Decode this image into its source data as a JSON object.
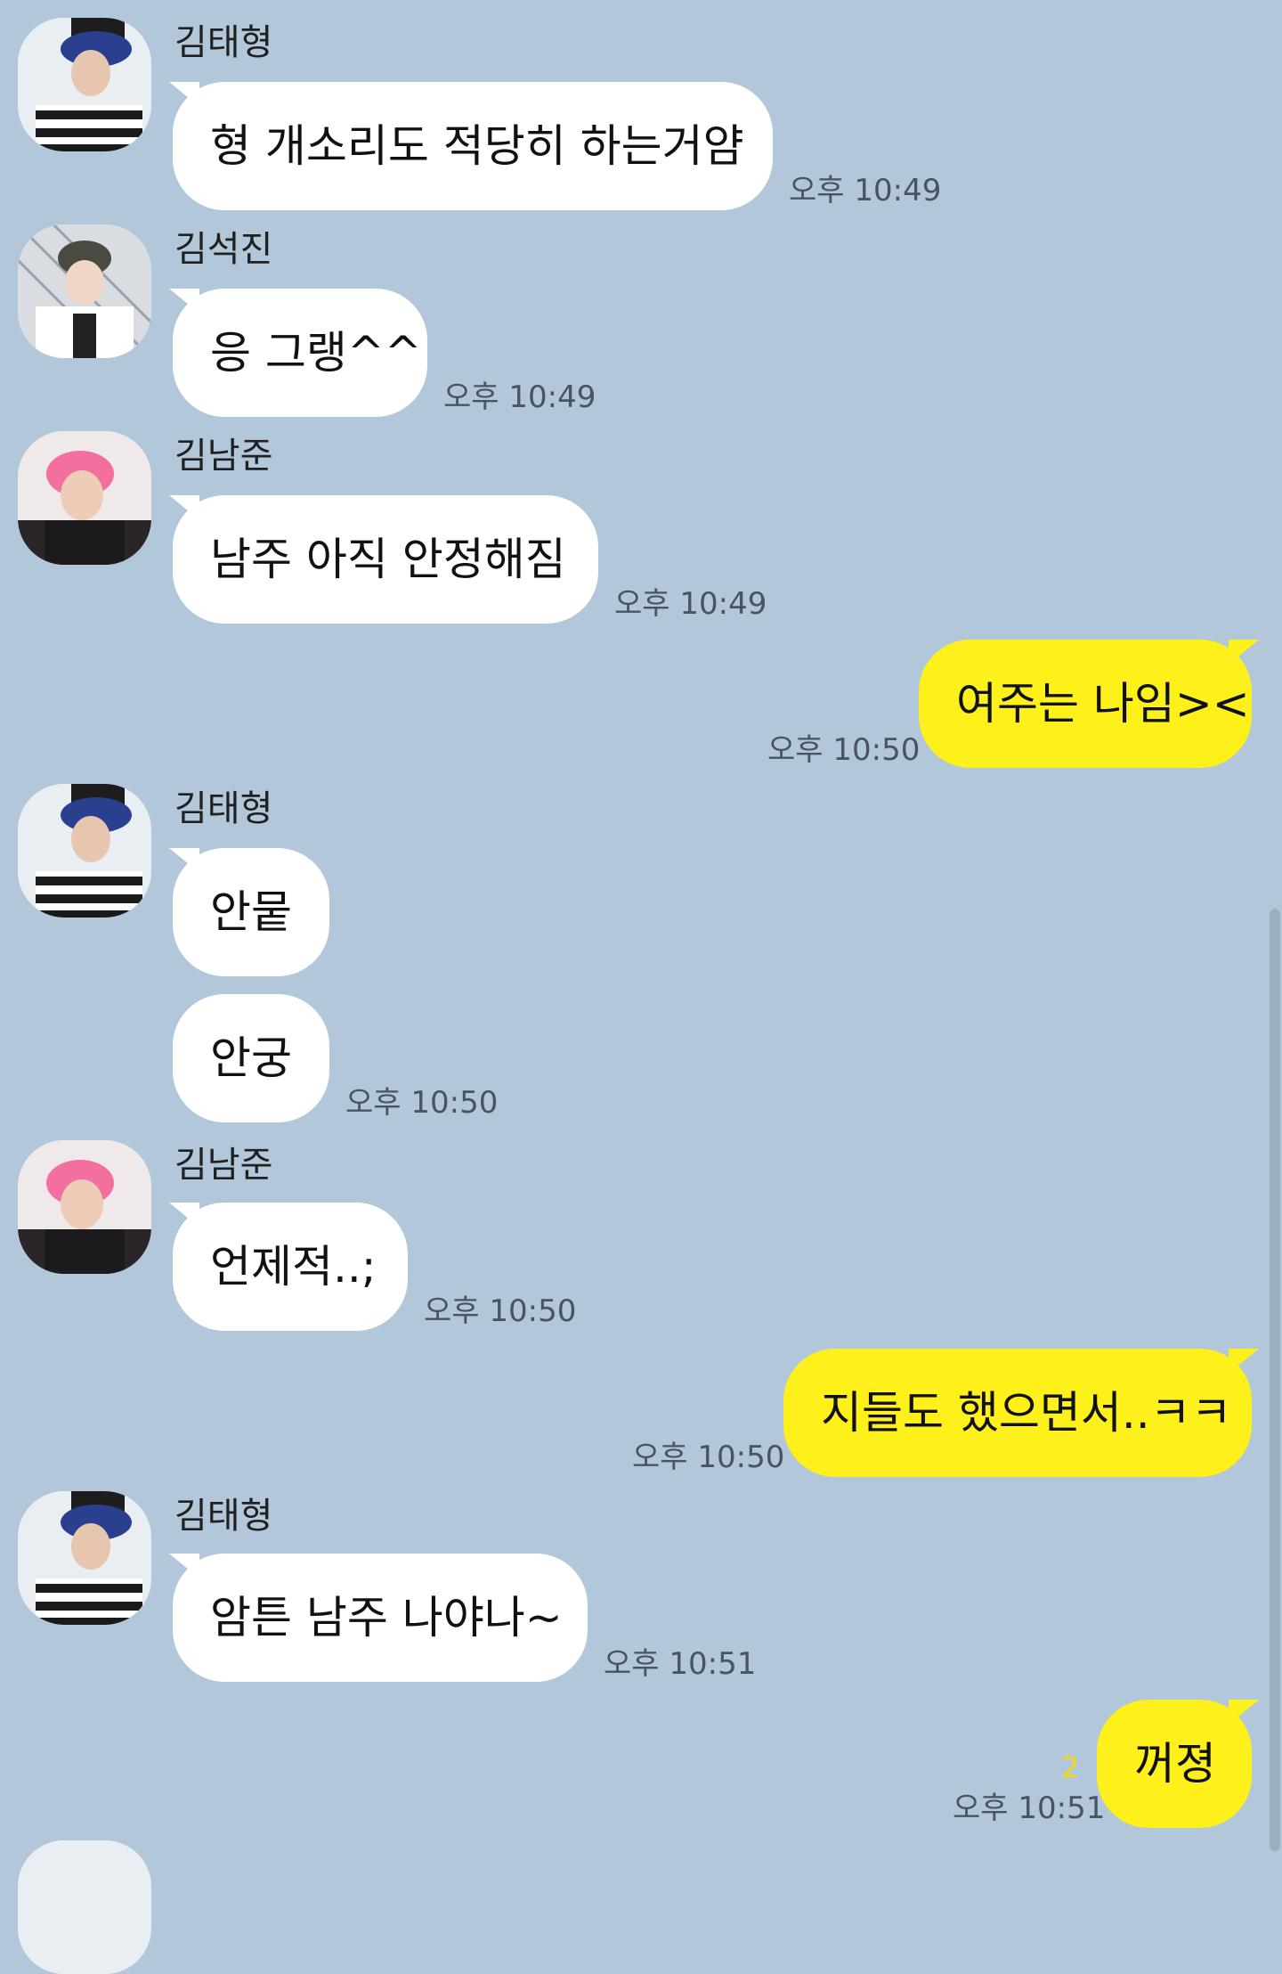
{
  "messages": {
    "m1": {
      "sender": "김태형",
      "text": "형 개소리도 적당히 하는거얌",
      "time": "오후 10:49"
    },
    "m2": {
      "sender": "김석진",
      "text": "응 그랭^^",
      "time": "오후 10:49"
    },
    "m3": {
      "sender": "김남준",
      "text": "남주 아직 안정해짐",
      "time": "오후 10:49"
    },
    "m4": {
      "text": "여주는 나임><",
      "time": "오후 10:50"
    },
    "m5": {
      "sender": "김태형",
      "text": "안뭍",
      "text2": "안궁",
      "time": "오후 10:50"
    },
    "m6": {
      "sender": "김남준",
      "text": "언제적..;",
      "time": "오후 10:50"
    },
    "m7": {
      "text": "지들도 했으면서..ㅋㅋ",
      "time": "오후 10:50"
    },
    "m8": {
      "sender": "김태형",
      "text": "암튼 남주 나야나~",
      "time": "오후 10:51"
    },
    "m9": {
      "text": "꺼졍",
      "time": "오후 10:51",
      "unread": "2"
    }
  },
  "colors": {
    "background": "#b2c7da",
    "incoming_bubble": "#ffffff",
    "outgoing_bubble": "#fef01b",
    "unread_count": "#f5d70f"
  },
  "icons": {
    "avatar_taehyung": "profile-photo-icon",
    "avatar_seokjin": "profile-photo-icon",
    "avatar_namjoon": "profile-photo-icon"
  }
}
